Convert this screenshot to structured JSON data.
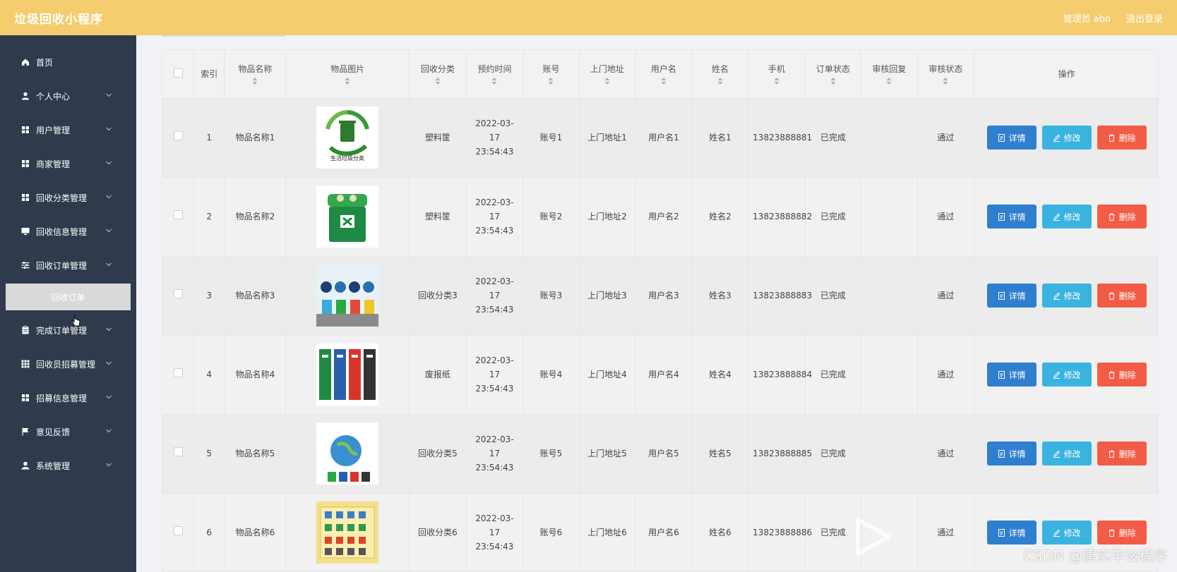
{
  "header": {
    "title": "垃圾回收小程序",
    "admin": "管理员 abo",
    "logout": "退出登录"
  },
  "colors": {
    "topbar": "#f5cd6e",
    "sidebar": "#2f3b4d",
    "detail": "#2f7fcf",
    "edit": "#3bb3e0",
    "delete": "#f25c47"
  },
  "sidebar": {
    "items": [
      {
        "label": "首页",
        "icon": "home-icon",
        "chev": false
      },
      {
        "label": "个人中心",
        "icon": "user-icon",
        "chev": true
      },
      {
        "label": "用户管理",
        "icon": "grid-icon",
        "chev": true
      },
      {
        "label": "商家管理",
        "icon": "grid-icon",
        "chev": true
      },
      {
        "label": "回收分类管理",
        "icon": "grid-icon",
        "chev": true
      },
      {
        "label": "回收信息管理",
        "icon": "monitor-icon",
        "chev": true
      },
      {
        "label": "回收订单管理",
        "icon": "sliders-icon",
        "chev": true
      }
    ],
    "sub_item": "回收订单",
    "items2": [
      {
        "label": "完成订单管理",
        "icon": "clipboard-icon",
        "chev": true
      },
      {
        "label": "回收员招募管理",
        "icon": "apps-icon",
        "chev": true
      },
      {
        "label": "招募信息管理",
        "icon": "grid-icon",
        "chev": true
      },
      {
        "label": "意见反馈",
        "icon": "flag-icon",
        "chev": true
      },
      {
        "label": "系统管理",
        "icon": "person-icon",
        "chev": true
      }
    ]
  },
  "table": {
    "columns": [
      "索引",
      "物品名称",
      "物品图片",
      "回收分类",
      "预约时间",
      "账号",
      "上门地址",
      "用户名",
      "姓名",
      "手机",
      "订单状态",
      "审核回复",
      "审核状态",
      "操作"
    ],
    "buttons": {
      "detail": "详情",
      "edit": "修改",
      "delete": "删除"
    },
    "rows": [
      {
        "index": "1",
        "name": "物品名称1",
        "image": "garbage-sorting-logo",
        "category": "塑料筐",
        "time": "2022-03-17 23:54:43",
        "account": "账号1",
        "address": "上门地址1",
        "username": "用户名1",
        "realname": "姓名1",
        "phone": "13823888881",
        "status": "已完成",
        "reply": "",
        "audit": "通过"
      },
      {
        "index": "2",
        "name": "物品名称2",
        "image": "green-bin",
        "category": "塑料筐",
        "time": "2022-03-17 23:54:43",
        "account": "账号2",
        "address": "上门地址2",
        "username": "用户名2",
        "realname": "姓名2",
        "phone": "13823888882",
        "status": "已完成",
        "reply": "",
        "audit": "通过"
      },
      {
        "index": "3",
        "name": "物品名称3",
        "image": "bins-cartoon",
        "category": "回收分类3",
        "time": "2022-03-17 23:54:43",
        "account": "账号3",
        "address": "上门地址3",
        "username": "用户名3",
        "realname": "姓名3",
        "phone": "13823888883",
        "status": "已完成",
        "reply": "",
        "audit": "通过"
      },
      {
        "index": "4",
        "name": "物品名称4",
        "image": "four-bins",
        "category": "废报纸",
        "time": "2022-03-17 23:54:43",
        "account": "账号4",
        "address": "上门地址4",
        "username": "用户名4",
        "realname": "姓名4",
        "phone": "13823888884",
        "status": "已完成",
        "reply": "",
        "audit": "通过"
      },
      {
        "index": "5",
        "name": "物品名称5",
        "image": "earth-bins",
        "category": "回收分类5",
        "time": "2022-03-17 23:54:43",
        "account": "账号5",
        "address": "上门地址5",
        "username": "用户名5",
        "realname": "姓名5",
        "phone": "13823888885",
        "status": "已完成",
        "reply": "",
        "audit": "通过"
      },
      {
        "index": "6",
        "name": "物品名称6",
        "image": "sorting-chart",
        "category": "回收分类6",
        "time": "2022-03-17 23:54:43",
        "account": "账号6",
        "address": "上门地址6",
        "username": "用户名6",
        "realname": "姓名6",
        "phone": "13823888886",
        "status": "已完成",
        "reply": "",
        "audit": "通过"
      }
    ]
  },
  "watermark": "CSDN @唐实毕设程序"
}
